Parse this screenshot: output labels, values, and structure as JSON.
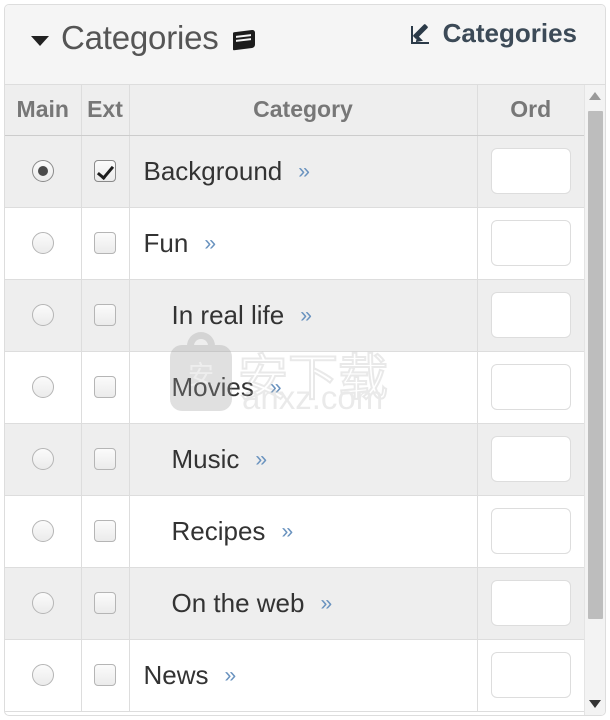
{
  "panel": {
    "title": "Categories",
    "title_icon": "book-icon",
    "collapse_icon": "caret-down-icon",
    "action": {
      "icon": "pencil-square-icon",
      "label": "Categories"
    }
  },
  "table": {
    "columns": [
      {
        "key": "main",
        "label": "Main"
      },
      {
        "key": "ext",
        "label": "Ext"
      },
      {
        "key": "category",
        "label": "Category"
      },
      {
        "key": "ord",
        "label": "Ord"
      }
    ],
    "link_glyph": "»",
    "rows": [
      {
        "main_selected": true,
        "ext_checked": true,
        "category": "Background",
        "indent": 0,
        "ord": ""
      },
      {
        "main_selected": false,
        "ext_checked": false,
        "category": "Fun",
        "indent": 0,
        "ord": ""
      },
      {
        "main_selected": false,
        "ext_checked": false,
        "category": "In real life",
        "indent": 1,
        "ord": ""
      },
      {
        "main_selected": false,
        "ext_checked": false,
        "category": "Movies",
        "indent": 1,
        "ord": ""
      },
      {
        "main_selected": false,
        "ext_checked": false,
        "category": "Music",
        "indent": 1,
        "ord": ""
      },
      {
        "main_selected": false,
        "ext_checked": false,
        "category": "Recipes",
        "indent": 1,
        "ord": ""
      },
      {
        "main_selected": false,
        "ext_checked": false,
        "category": "On the web",
        "indent": 1,
        "ord": ""
      },
      {
        "main_selected": false,
        "ext_checked": false,
        "category": "News",
        "indent": 0,
        "ord": ""
      }
    ]
  },
  "scrollbar": {
    "up_icon": "triangle-up-icon",
    "down_icon": "triangle-down-icon"
  },
  "watermark": {
    "bag_glyph": "安",
    "text_cn": "安下载",
    "url": "anxz.com"
  },
  "colors": {
    "header_bg": "#f5f5f5",
    "row_alt_bg": "#eeeeee",
    "border": "#dddddd",
    "link": "#6a93bf",
    "title_text": "#555555",
    "action_text": "#3c4a57"
  }
}
